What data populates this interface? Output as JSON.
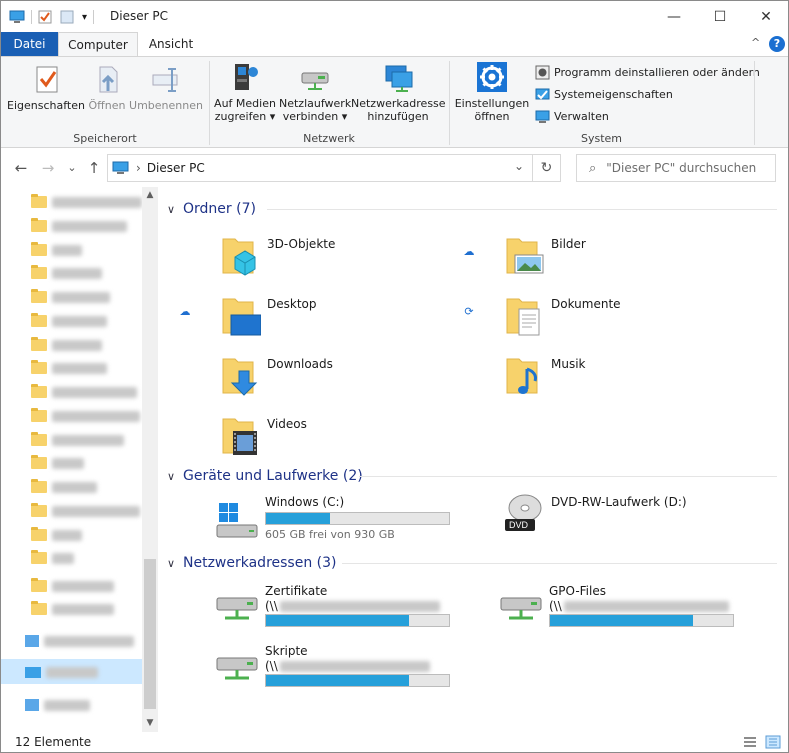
{
  "window": {
    "title": "Dieser PC",
    "minimize": "—",
    "maximize": "☐",
    "close": "✕"
  },
  "ribbon_tabs": [
    {
      "label": "Datei"
    },
    {
      "label": "Computer"
    },
    {
      "label": "Ansicht"
    }
  ],
  "ribbon": {
    "collapse": "^",
    "help": "?",
    "groups": {
      "speicherort": "Speicherort",
      "netzwerk": "Netzwerk",
      "system": "System"
    },
    "buttons": {
      "eigenschaften": "Eigenschaften",
      "oeffnen": "Öffnen",
      "umbenennen": "Umbenennen",
      "medien_line1": "Auf Medien",
      "medien_line2": "zugreifen ▾",
      "laufwerk_line1": "Netzlaufwerk",
      "laufwerk_line2": "verbinden ▾",
      "netzadresse_line1": "Netzwerkadresse",
      "netzadresse_line2": "hinzufügen",
      "einstellungen_line1": "Einstellungen",
      "einstellungen_line2": "öffnen",
      "programm": "Programm deinstallieren oder ändern",
      "systemeigenschaften": "Systemeigenschaften",
      "verwalten": "Verwalten"
    }
  },
  "nav": {
    "back": "←",
    "forward": "→",
    "recent": "⌄",
    "up": "↑",
    "address_sep": "›",
    "address": "Dieser PC",
    "address_dropdown": "⌄",
    "refresh": "↻",
    "search_placeholder": "\"Dieser PC\" durchsuchen"
  },
  "sections": {
    "ordner": "Ordner (7)",
    "geraete": "Geräte und Laufwerke (2)",
    "netzwerk": "Netzwerkadressen (3)"
  },
  "folders": [
    {
      "label": "3D-Objekte"
    },
    {
      "label": "Bilder"
    },
    {
      "label": "Desktop"
    },
    {
      "label": "Dokumente"
    },
    {
      "label": "Downloads"
    },
    {
      "label": "Musik"
    },
    {
      "label": "Videos"
    }
  ],
  "drives": [
    {
      "label": "Windows (C:)",
      "free": "605 GB frei von 930 GB",
      "used_fraction": 0.35
    },
    {
      "label": "DVD-RW-Laufwerk (D:)"
    }
  ],
  "network": [
    {
      "label": "Zertifikate",
      "path_prefix": "(\\\\",
      "used_fraction": 0.78
    },
    {
      "label": "GPO-Files",
      "path_prefix": "(\\\\",
      "used_fraction": 0.78
    },
    {
      "label": "Skripte",
      "path_prefix": "(\\\\",
      "used_fraction": 0.78
    }
  ],
  "status": {
    "count": "12 Elemente"
  },
  "colors": {
    "accent": "#1a5fb4",
    "bar": "#26a0da",
    "section_header": "#1e3287"
  }
}
